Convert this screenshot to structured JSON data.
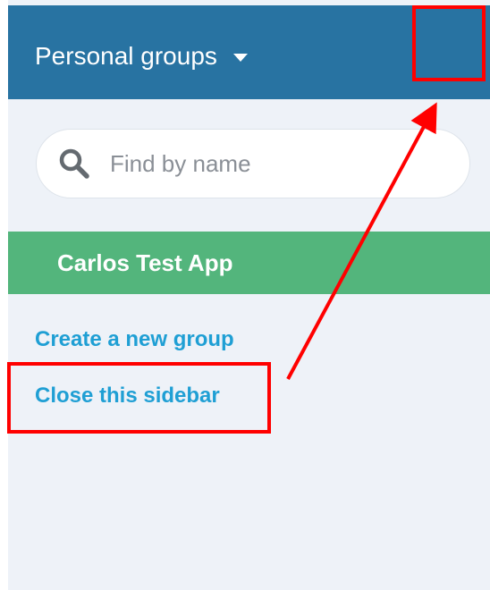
{
  "header": {
    "title": "Personal groups",
    "dropdown_icon": "caret-down-icon",
    "background_color": "#2873a2"
  },
  "search": {
    "placeholder": "Find by name",
    "value": "",
    "icon": "search-icon"
  },
  "groups": [
    {
      "label": "Carlos Test App",
      "selected": true,
      "color": "#53b57c"
    }
  ],
  "links": {
    "create": "Create a new group",
    "close": "Close this sidebar",
    "color": "#1f9fd4"
  },
  "annotations": {
    "highlight_color": "#ff0000",
    "arrow_icon": "arrow-icon"
  }
}
